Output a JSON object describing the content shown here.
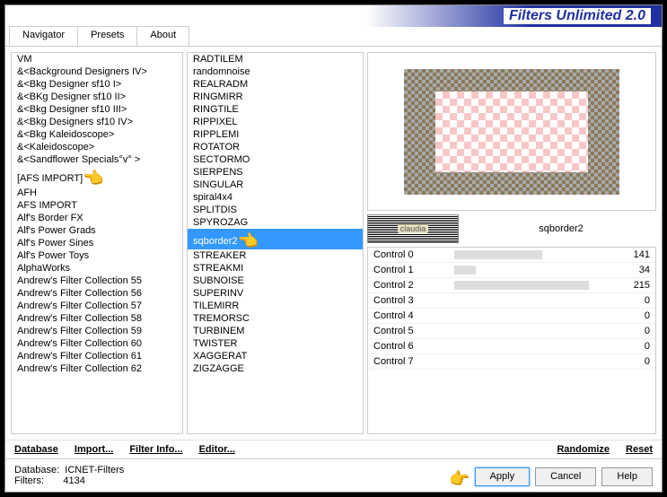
{
  "title": "Filters Unlimited 2.0",
  "tabs": [
    "Navigator",
    "Presets",
    "About"
  ],
  "left_selected_index": 8,
  "left_list": [
    "VM",
    "&<Background Designers IV>",
    "&<Bkg Designer sf10 I>",
    "&<BKg Designer sf10 II>",
    "&<Bkg Designer sf10 III>",
    "&<Bkg Designers sf10 IV>",
    "&<Bkg Kaleidoscope>",
    "&<Kaleidoscope>",
    "&<Sandflower Specials°v° >",
    "[AFS IMPORT]",
    "AFH",
    "AFS IMPORT",
    "Alf's Border FX",
    "Alf's Power Grads",
    "Alf's Power Sines",
    "Alf's Power Toys",
    "AlphaWorks",
    "Andrew's Filter Collection 55",
    "Andrew's Filter Collection 56",
    "Andrew's Filter Collection 57",
    "Andrew's Filter Collection 58",
    "Andrew's Filter Collection 59",
    "Andrew's Filter Collection 60",
    "Andrew's Filter Collection 61",
    "Andrew's Filter Collection 62"
  ],
  "mid_selected_index": 13,
  "mid_list": [
    "RADTILEM",
    "randomnoise",
    "REALRADM",
    "RINGMIRR",
    "RINGTILE",
    "RIPPIXEL",
    "RIPPLEMI",
    "ROTATOR",
    "SECTORMO",
    "SIERPENS",
    "SINGULAR",
    "spiral4x4",
    "SPLITDIS",
    "SPYROZAG",
    "sqborder2",
    "STREAKER",
    "STREAKMI",
    "SUBNOISE",
    "SUPERINV",
    "TILEMIRR",
    "TREMORSC",
    "TURBINEM",
    "TWISTER",
    "XAGGERAT",
    "ZIGZAGGE"
  ],
  "filter_name": "sqborder2",
  "controls": [
    {
      "name": "Control 0",
      "value": 141,
      "max": 255
    },
    {
      "name": "Control 1",
      "value": 34,
      "max": 255
    },
    {
      "name": "Control 2",
      "value": 215,
      "max": 255
    },
    {
      "name": "Control 3",
      "value": 0,
      "max": 255
    },
    {
      "name": "Control 4",
      "value": 0,
      "max": 255
    },
    {
      "name": "Control 5",
      "value": 0,
      "max": 255
    },
    {
      "name": "Control 6",
      "value": 0,
      "max": 255
    },
    {
      "name": "Control 7",
      "value": 0,
      "max": 255
    }
  ],
  "links": {
    "database": "Database",
    "import": "Import...",
    "filterinfo": "Filter Info...",
    "editor": "Editor...",
    "randomize": "Randomize",
    "reset": "Reset"
  },
  "status": {
    "db_label": "Database:",
    "db_value": "ICNET-Filters",
    "filters_label": "Filters:",
    "filters_value": "4134"
  },
  "buttons": {
    "apply": "Apply",
    "cancel": "Cancel",
    "help": "Help"
  }
}
